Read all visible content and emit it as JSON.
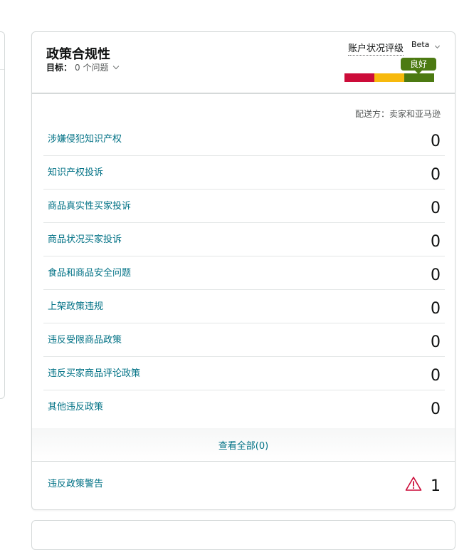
{
  "card": {
    "title": "政策合规性",
    "target_label": "目标：",
    "target_value": "0 个问题"
  },
  "health": {
    "title": "账户状况评级",
    "beta": "Beta",
    "status": "良好",
    "colors": {
      "red": "#cc0c39",
      "yellow": "#f7b90d",
      "green": "#4c7a12"
    }
  },
  "fulfilled_by": "配送方：卖家和亚马逊",
  "rows": [
    {
      "label": "涉嫌侵犯知识产权",
      "value": "0"
    },
    {
      "label": "知识产权投诉",
      "value": "0"
    },
    {
      "label": "商品真实性买家投诉",
      "value": "0"
    },
    {
      "label": "商品状况买家投诉",
      "value": "0"
    },
    {
      "label": "食品和商品安全问题",
      "value": "0"
    },
    {
      "label": "上架政策违规",
      "value": "0"
    },
    {
      "label": "违反受限商品政策",
      "value": "0"
    },
    {
      "label": "违反买家商品评论政策",
      "value": "0"
    },
    {
      "label": "其他违反政策",
      "value": "0"
    }
  ],
  "view_all": "查看全部(0)",
  "warnings": {
    "label": "违反政策警告",
    "value": "1",
    "icon": "warning-triangle-icon",
    "icon_color": "#cc0c39"
  }
}
